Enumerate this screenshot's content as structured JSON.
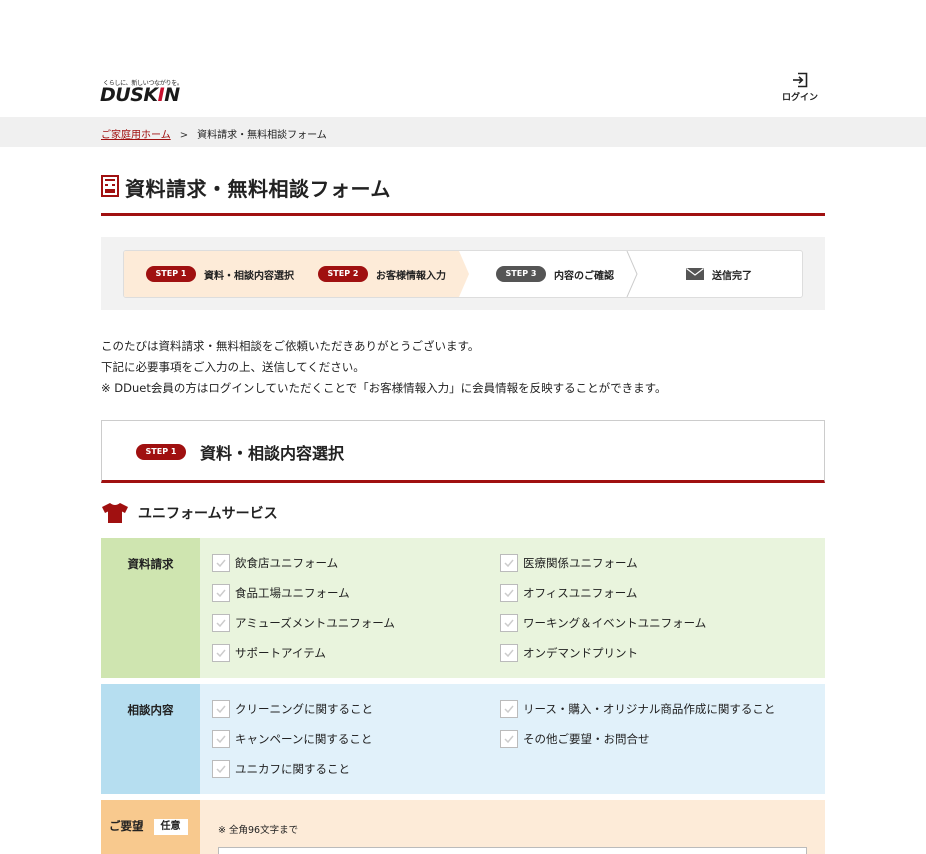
{
  "header": {
    "logo_tagline": "くらしに、新しいつながりを。",
    "logo_text_main": "DUSK",
    "logo_text_accent": "I",
    "logo_text_end": "N",
    "login_label": "ログイン"
  },
  "breadcrumb": {
    "home": "ご家庭用ホーム",
    "separator": ">",
    "current": "資料請求・無料相談フォーム"
  },
  "page_title": "資料請求・無料相談フォーム",
  "steps": [
    {
      "pill": "STEP 1",
      "label": "資料・相談内容選択",
      "state": "done"
    },
    {
      "pill": "STEP 2",
      "label": "お客様情報入力",
      "state": "done"
    },
    {
      "pill": "STEP 3",
      "label": "内容のご確認",
      "state": "todo"
    },
    {
      "pill": "",
      "label": "送信完了",
      "icon": "mail-icon",
      "state": "todo"
    }
  ],
  "intro": [
    "このたびは資料請求・無料相談をご依頼いただきありがとうございます。",
    "下記に必要事項をご入力の上、送信してください。",
    "※ DDuet会員の方はログインしていただくことで「お客様情報入力」に会員情報を反映することができます。"
  ],
  "section": {
    "pill": "STEP 1",
    "title": "資料・相談内容選択"
  },
  "service": {
    "title": "ユニフォームサービス",
    "icon": "shirt-icon"
  },
  "material": {
    "label": "資料請求",
    "options": [
      "飲食店ユニフォーム",
      "医療関係ユニフォーム",
      "食品工場ユニフォーム",
      "オフィスユニフォーム",
      "アミューズメントユニフォーム",
      "ワーキング＆イベントユニフォーム",
      "サポートアイテム",
      "オンデマンドプリント"
    ]
  },
  "consult": {
    "label": "相談内容",
    "options": [
      "クリーニングに関すること",
      "リース・購入・オリジナル商品作成に関すること",
      "キャンペーンに関すること",
      "その他ご要望・お問合せ",
      "ユニカフに関すること"
    ]
  },
  "request": {
    "label": "ご要望",
    "optional": "任意",
    "note": "※ 全角96文字まで",
    "value": ""
  },
  "colors": {
    "brand_red": "#a01010",
    "material_header": "#cfe5b0",
    "material_bg": "#e9f4dd",
    "consult_header": "#b6def0",
    "consult_bg": "#e1f1fa",
    "request_header": "#f8c98e",
    "request_bg": "#fdebd8"
  }
}
